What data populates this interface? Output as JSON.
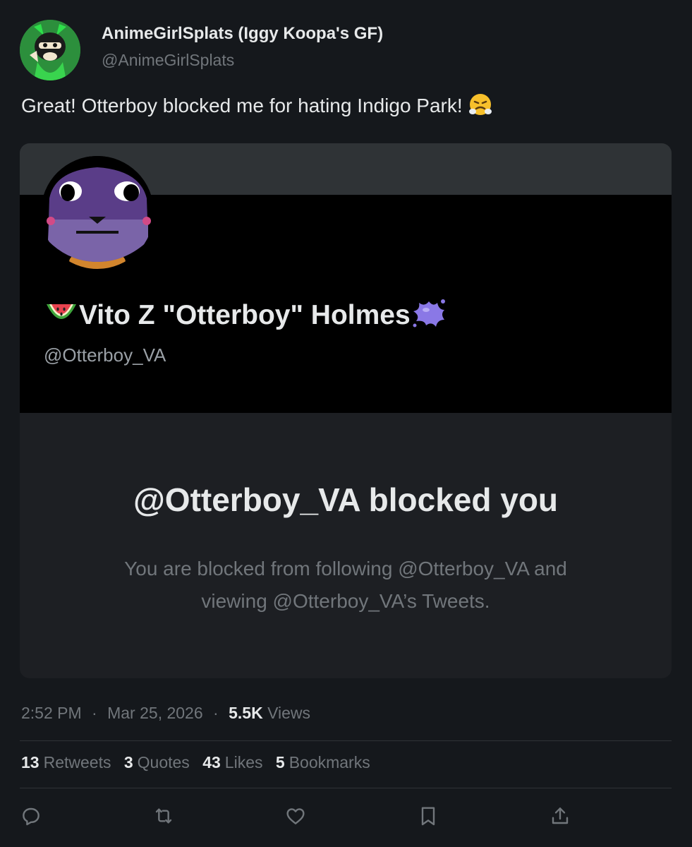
{
  "author": {
    "display_name": "AnimeGirlSplats (Iggy Koopa's GF)",
    "handle": "@AnimeGirlSplats",
    "avatar_icon": "avatar-icon"
  },
  "tweet": {
    "text": "Great! Otterboy blocked me for hating Indigo Park!",
    "emoji_icon": "steam-from-nose-emoji"
  },
  "card": {
    "profile_name": "Vito Z \"Otterboy\" Holmes",
    "profile_handle": "@Otterboy_VA",
    "blocked_title": "@Otterboy_VA blocked you",
    "blocked_line1": "You are blocked from following @Otterboy_VA and",
    "blocked_line2": "viewing @Otterboy_VA’s Tweets.",
    "name_prefix_icon": "watermelon-emoji",
    "name_suffix_icon": "splat-emoji"
  },
  "meta": {
    "time": "2:52 PM",
    "separator": "·",
    "date": "Mar 25, 2026",
    "views_count": "5.5K",
    "views_label": "Views"
  },
  "stats": {
    "retweets_count": "13",
    "retweets_label": "Retweets",
    "quotes_count": "3",
    "quotes_label": "Quotes",
    "likes_count": "43",
    "likes_label": "Likes",
    "bookmarks_count": "5",
    "bookmarks_label": "Bookmarks"
  },
  "actions": [
    "reply-icon",
    "retweet-icon",
    "like-icon",
    "bookmark-icon",
    "share-icon"
  ],
  "colors": {
    "background": "#15181c",
    "card_background": "#1d1f23",
    "muted_text": "#71767b",
    "primary_text": "#e7e9ea"
  }
}
